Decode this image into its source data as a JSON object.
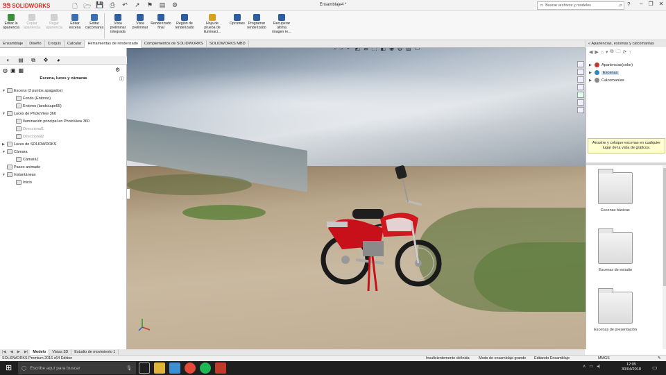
{
  "app": {
    "brand": "SOLIDWORKS",
    "doc_title": "Ensamblaje4 *",
    "search_placeholder": "Buscar archivos y modelos",
    "help": "?"
  },
  "ribbon": {
    "buttons": [
      {
        "label": "Editar la apariencia",
        "color": "#3a8e3a",
        "enabled": true
      },
      {
        "label": "Copiar apariencia",
        "color": "#999999",
        "enabled": false
      },
      {
        "label": "Pegar apariencia",
        "color": "#999999",
        "enabled": false
      },
      {
        "label": "Editar escena",
        "color": "#3a6fb0",
        "enabled": true
      },
      {
        "label": "Editar calcomanía",
        "color": "#3a6fb0",
        "enabled": true
      },
      {
        "label": "Vista preliminar integrada",
        "color": "#2e5e9e",
        "enabled": true
      },
      {
        "label": "Vista preliminar",
        "color": "#2e5e9e",
        "enabled": true
      },
      {
        "label": "Renderizado final",
        "color": "#2e5e9e",
        "enabled": true
      },
      {
        "label": "Región de renderizado",
        "color": "#2e5e9e",
        "enabled": true
      },
      {
        "label": "Hoja de prueba de iluminaci...",
        "color": "#d8a020",
        "enabled": true
      },
      {
        "label": "Opciones",
        "color": "#2e5e9e",
        "enabled": true
      },
      {
        "label": "Programar renderizado",
        "color": "#2e5e9e",
        "enabled": true
      },
      {
        "label": "Recuperar última imagen re...",
        "color": "#2e5e9e",
        "enabled": true
      }
    ]
  },
  "tabs": [
    "Ensamblaje",
    "Diseño",
    "Croquis",
    "Calcular",
    "Herramientas de renderizado",
    "Complementos de SOLIDWORKS",
    "SOLIDWORKS MBD"
  ],
  "active_tab": "Herramientas de renderizado",
  "left_panel": {
    "title": "Escena, luces y cámaras",
    "tree": [
      {
        "label": "Escena (3 puntos apagados)",
        "level": 0,
        "twist": "▼",
        "dim": false
      },
      {
        "label": "Fondo (Entorno)",
        "level": 1,
        "twist": "",
        "dim": false
      },
      {
        "label": "Entorno (landscape05)",
        "level": 1,
        "twist": "",
        "dim": false
      },
      {
        "label": "Luces de PhotoView 360",
        "level": 0,
        "twist": "▼",
        "dim": false
      },
      {
        "label": "Iluminación principal en PhotoView 360",
        "level": 1,
        "twist": "",
        "dim": false
      },
      {
        "label": "Direccional1",
        "level": 1,
        "twist": "",
        "dim": true
      },
      {
        "label": "Direccional2",
        "level": 1,
        "twist": "",
        "dim": true
      },
      {
        "label": "Luces de SOLIDWORKS",
        "level": 0,
        "twist": "▶",
        "dim": false
      },
      {
        "label": "Cámara",
        "level": 0,
        "twist": "▼",
        "dim": false
      },
      {
        "label": "Cámara1",
        "level": 1,
        "twist": "",
        "dim": false
      },
      {
        "label": "Paseo animado",
        "level": 0,
        "twist": "",
        "dim": false
      },
      {
        "label": "Instantáneas",
        "level": 0,
        "twist": "▼",
        "dim": false
      },
      {
        "label": "Inicio",
        "level": 1,
        "twist": "",
        "dim": false
      }
    ]
  },
  "right_panel": {
    "header": "Apariencias, escenas y calcomanías",
    "tree": [
      {
        "label": "Apariencias(color)",
        "color": "#c0392b",
        "selected": false
      },
      {
        "label": "Escenas",
        "color": "#2e86c1",
        "selected": true
      },
      {
        "label": "Calcomanías",
        "color": "#888888",
        "selected": false
      }
    ],
    "tip": "Arrastre y coloque escenas en cualquier lugar de la vista de gráficos.",
    "folders": [
      "Escenas básicas",
      "Escenas de estudio",
      "Escenas de presentación"
    ]
  },
  "bottom_tabs": [
    "Modelo",
    "Vistas 3D",
    "Estudio de movimiento 1"
  ],
  "active_bottom_tab": "Modelo",
  "status": {
    "edition": "SOLIDWORKS Premium 2016 x64 Edition",
    "state": "Insuficientemente definida",
    "mode": "Modo de ensamblaje grande",
    "editing": "Editando Ensamblaje",
    "units": "MMGS"
  },
  "taskbar": {
    "search_placeholder": "Escribe aquí para buscar",
    "time": "12:05",
    "date": "30/04/2018"
  }
}
